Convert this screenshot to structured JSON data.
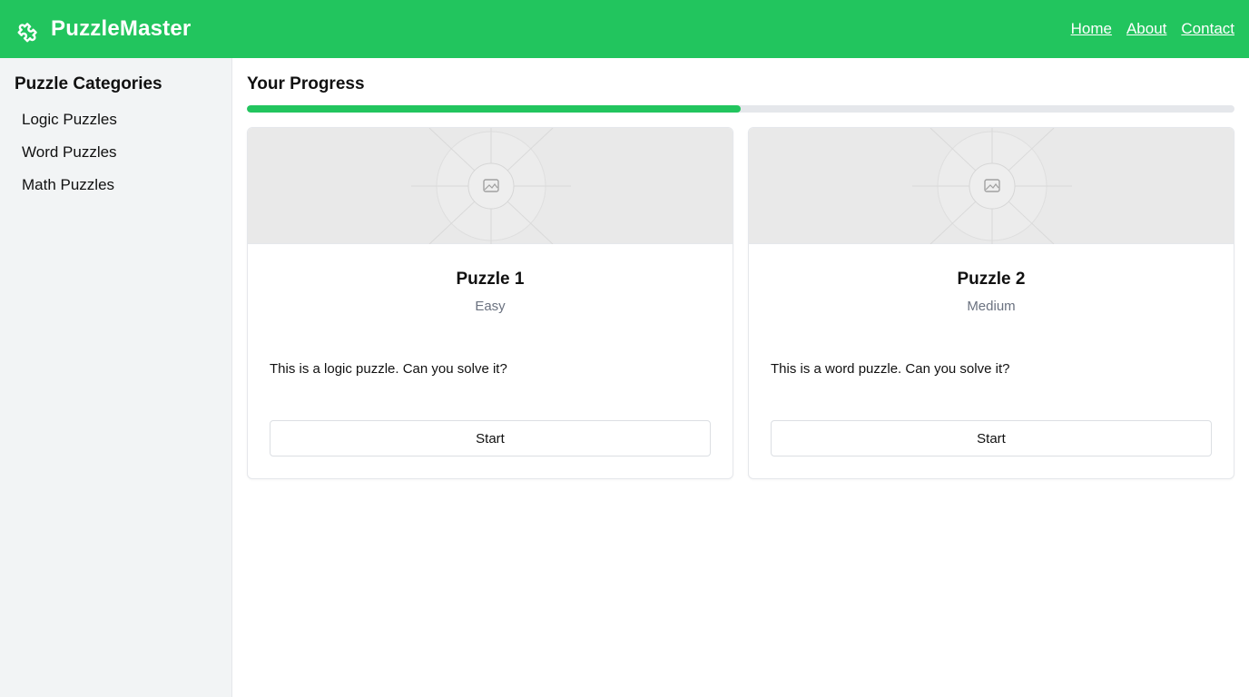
{
  "header": {
    "brand_name": "PuzzleMaster",
    "brand_icon": "puzzle-piece-icon",
    "nav": [
      "Home",
      "About",
      "Contact"
    ]
  },
  "sidebar": {
    "title": "Puzzle Categories",
    "items": [
      "Logic Puzzles",
      "Word Puzzles",
      "Math Puzzles"
    ]
  },
  "main": {
    "progress_title": "Your Progress",
    "progress_fraction": 0.5,
    "cards": [
      {
        "title": "Puzzle 1",
        "difficulty": "Easy",
        "description": "This is a logic puzzle. Can you solve it?",
        "button_label": "Start",
        "image_icon": "image-placeholder-icon"
      },
      {
        "title": "Puzzle 2",
        "difficulty": "Medium",
        "description": "This is a word puzzle. Can you solve it?",
        "button_label": "Start",
        "image_icon": "image-placeholder-icon"
      }
    ]
  },
  "colors": {
    "brand_green": "#22c55e",
    "sidebar_bg": "#f2f4f5",
    "muted_text": "#6b7280",
    "track_gray": "#e5e7eb"
  }
}
